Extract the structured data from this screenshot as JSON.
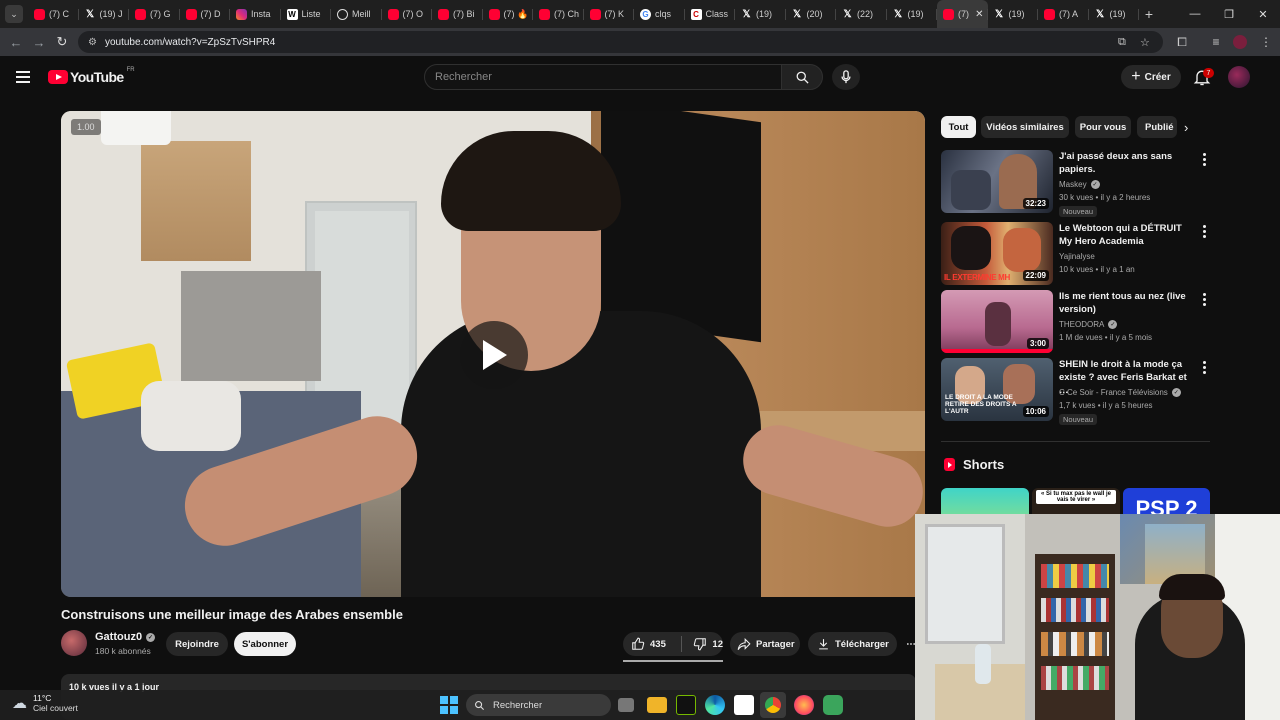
{
  "browser": {
    "tabs": [
      {
        "icon": "youtube",
        "label": "(7) C"
      },
      {
        "icon": "x",
        "label": "(19) J"
      },
      {
        "icon": "youtube",
        "label": "(7) G"
      },
      {
        "icon": "youtube",
        "label": "(7) D"
      },
      {
        "icon": "instagram",
        "label": "Insta"
      },
      {
        "icon": "wikipedia",
        "label": "Liste"
      },
      {
        "icon": "openai",
        "label": "Meill"
      },
      {
        "icon": "youtube",
        "label": "(7) O"
      },
      {
        "icon": "youtube",
        "label": "(7) Bi"
      },
      {
        "icon": "youtube",
        "label": "(7) 🔥"
      },
      {
        "icon": "youtube",
        "label": "(7) Ch"
      },
      {
        "icon": "youtube",
        "label": "(7) K"
      },
      {
        "icon": "google",
        "label": "clqs"
      },
      {
        "icon": "classroom",
        "label": "Class"
      },
      {
        "icon": "x",
        "label": "(19)"
      },
      {
        "icon": "x",
        "label": "(20)"
      },
      {
        "icon": "x",
        "label": "(22)"
      },
      {
        "icon": "x",
        "label": "(19)"
      },
      {
        "icon": "youtube",
        "label": "(7)",
        "active": true
      },
      {
        "icon": "x",
        "label": "(19)"
      },
      {
        "icon": "youtube",
        "label": "(7) A"
      },
      {
        "icon": "x",
        "label": "(19)"
      }
    ],
    "url": "youtube.com/watch?v=ZpSzTvSHPR4"
  },
  "youtube": {
    "logo_text": "YouTube",
    "country_code": "FR",
    "search_placeholder": "Rechercher",
    "create_label": "Créer",
    "notifications_count": "7"
  },
  "video": {
    "speed_label": "1.00",
    "title": "Construisons une meilleur image des Arabes ensemble",
    "channel_name": "Gattouz0",
    "subscribers": "180 k abonnés",
    "join_label": "Rejoindre",
    "subscribe_label": "S'abonner",
    "likes": "435",
    "dislikes": "12",
    "share_label": "Partager",
    "download_label": "Télécharger",
    "description_preview": "10 k vues  il y a 1 jour"
  },
  "chips": [
    "Tout",
    "Vidéos similaires",
    "Pour vous",
    "Publié"
  ],
  "recommendations": [
    {
      "title": "J'ai passé deux ans sans papiers.",
      "channel": "Maskey",
      "verified": true,
      "meta": "30 k vues • il y a 2 heures",
      "badge": "Nouveau",
      "duration": "32:23"
    },
    {
      "title": "Le Webtoon qui a DÉTRUIT My Hero Academia",
      "channel": "Yajinalyse",
      "verified": false,
      "meta": "10 k vues • il y a 1 an",
      "badge": "",
      "duration": "22:09",
      "thumb_text": "IL EXTERMINE MH"
    },
    {
      "title": "Ils me rient tous au nez (live version)",
      "channel": "THEODORA",
      "verified": true,
      "meta": "1 M de vues • il y a 5 mois",
      "badge": "",
      "duration": "3:00"
    },
    {
      "title": "SHEIN le droit à la mode ça existe ? avec Feris Barkat et …",
      "channel": "C Ce Soir - France Télévisions",
      "verified": true,
      "meta": "1,7 k vues • il y a 5 heures",
      "badge": "Nouveau",
      "duration": "10:06",
      "thumb_text": "LE DROIT A LA MODE RETIRE DES DROITS A L'AUTR"
    }
  ],
  "shorts": {
    "title": "Shorts",
    "items": [
      {
        "caption": ""
      },
      {
        "caption": "« Si tu max pas le wall je vais te virer »"
      },
      {
        "caption": "PSP 2"
      }
    ]
  },
  "taskbar": {
    "temperature": "11°C",
    "condition": "Ciel couvert",
    "search_label": "Rechercher"
  }
}
